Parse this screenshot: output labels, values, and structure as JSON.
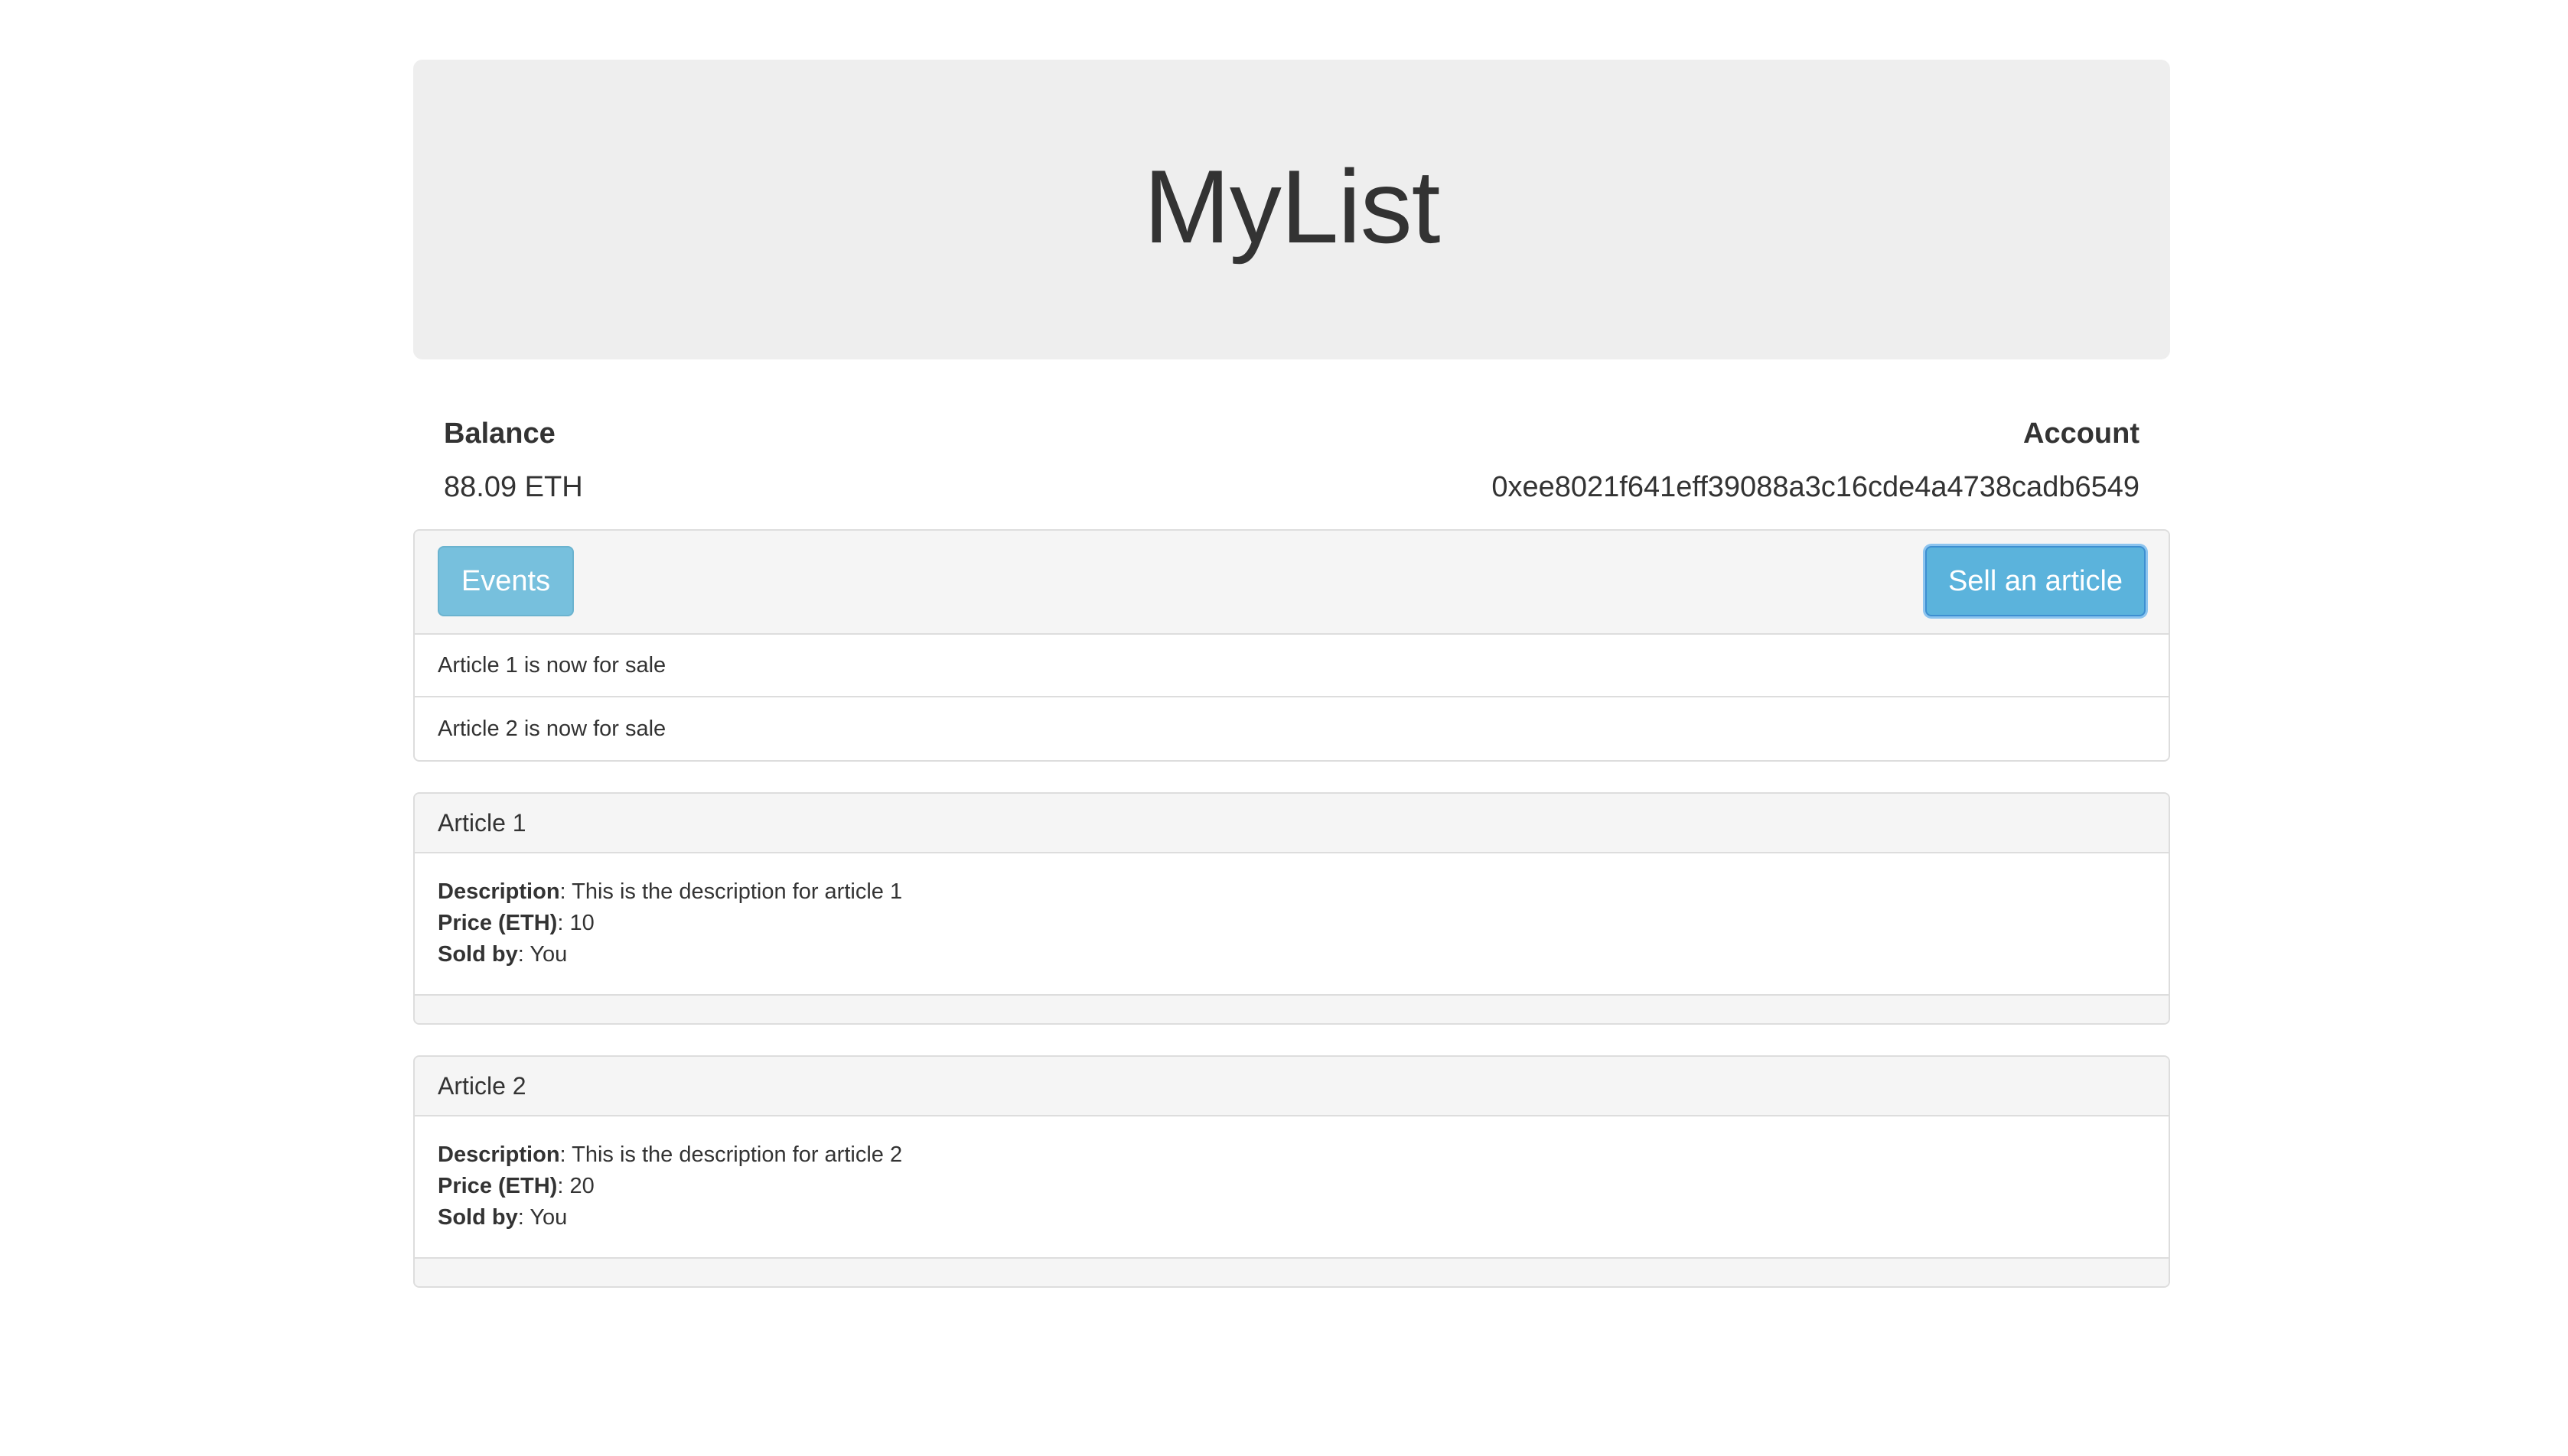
{
  "app": {
    "title": "MyList"
  },
  "balance": {
    "label": "Balance",
    "value": "88.09 ETH"
  },
  "account": {
    "label": "Account",
    "value": "0xee8021f641eff39088a3c16cde4a4738cadb6549"
  },
  "toolbar": {
    "events_label": "Events",
    "sell_label": "Sell an article"
  },
  "events": [
    {
      "text": "Article 1 is now for sale"
    },
    {
      "text": "Article 2 is now for sale"
    }
  ],
  "articles": [
    {
      "name": "Article 1",
      "description_label": "Description",
      "description": "This is the description for article 1",
      "price_label": "Price (ETH)",
      "price": "10",
      "seller_label": "Sold by",
      "seller": "You"
    },
    {
      "name": "Article 2",
      "description_label": "Description",
      "description": "This is the description for article 2",
      "price_label": "Price (ETH)",
      "price": "20",
      "seller_label": "Sold by",
      "seller": "You"
    }
  ]
}
